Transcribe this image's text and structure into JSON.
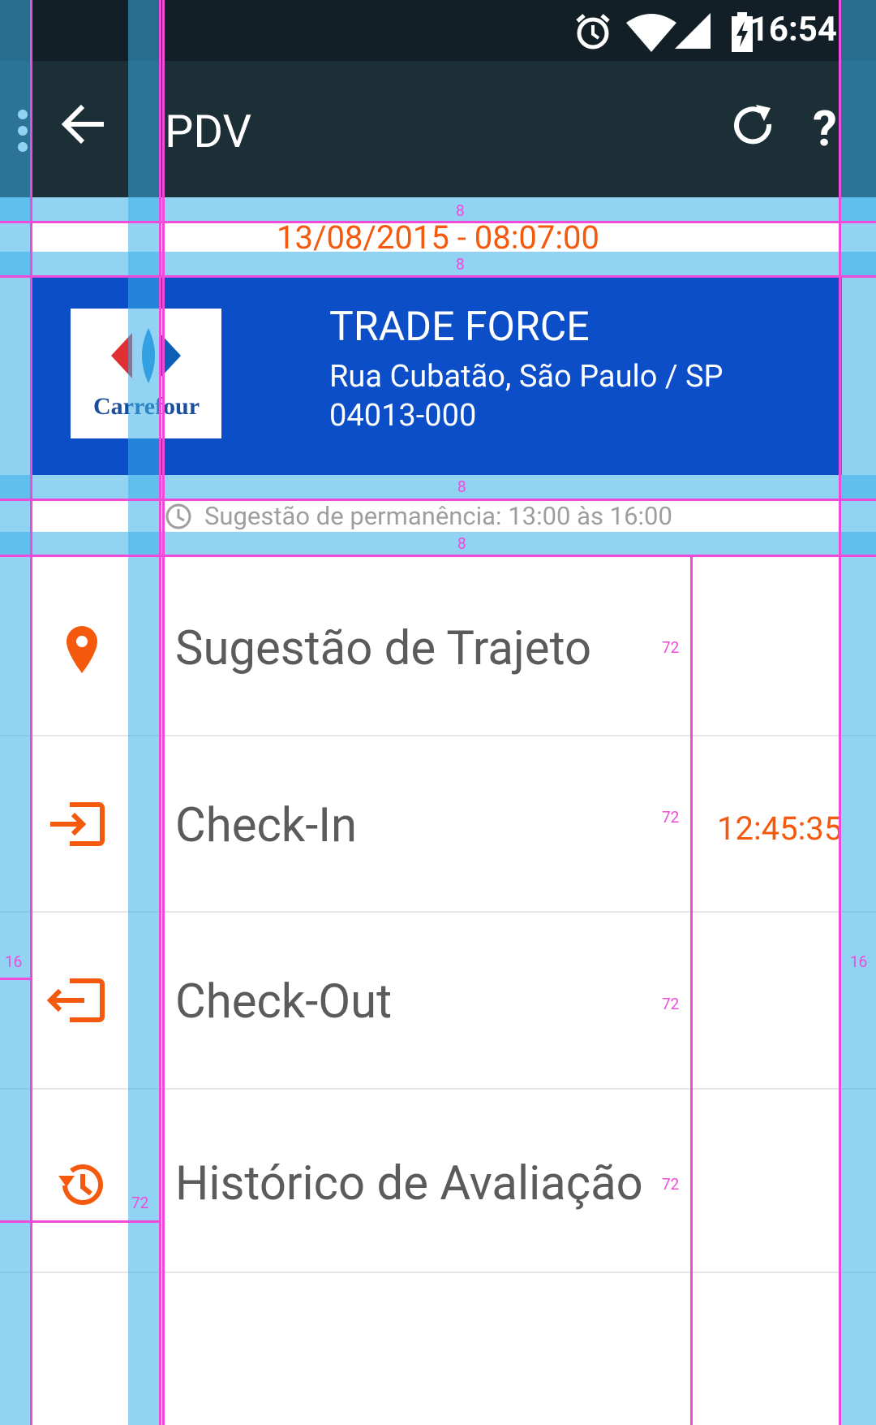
{
  "status_bar": {
    "time": "16:54",
    "icons": [
      "alarm-icon",
      "wifi-icon",
      "cell-signal-icon",
      "battery-charging-icon"
    ]
  },
  "toolbar": {
    "title": "PDV",
    "icons": [
      "overflow-icon",
      "back-arrow-icon",
      "refresh-icon",
      "help-icon"
    ]
  },
  "date_time": "13/08/2015 - 08:07:00",
  "store": {
    "logo_text": "Carrefour",
    "name": "TRADE FORCE",
    "address": "Rua Cubatão, São Paulo / SP",
    "zip": "04013-000"
  },
  "stay_suggestion": "Sugestão de permanência: 13:00 às 16:00",
  "menu": [
    {
      "label": "Sugestão de Trajeto",
      "icon": "location-pin-icon"
    },
    {
      "label": "Check-In",
      "icon": "check-in-icon",
      "timer": "12:45:35"
    },
    {
      "label": "Check-Out",
      "icon": "check-out-icon"
    },
    {
      "label": "Histórico de Avaliação",
      "icon": "history-icon"
    }
  ],
  "keylines": {
    "labels": [
      "8",
      "8",
      "8",
      "8",
      "16",
      "16",
      "72",
      "72",
      "72",
      "72",
      "72"
    ]
  },
  "colors": {
    "accent": "#f4590e",
    "toolbar": "#1c2e36",
    "status_bar": "#121f26",
    "card": "#0c4ec8",
    "keyline": "#ef4ad9",
    "band": "#38aee9"
  }
}
